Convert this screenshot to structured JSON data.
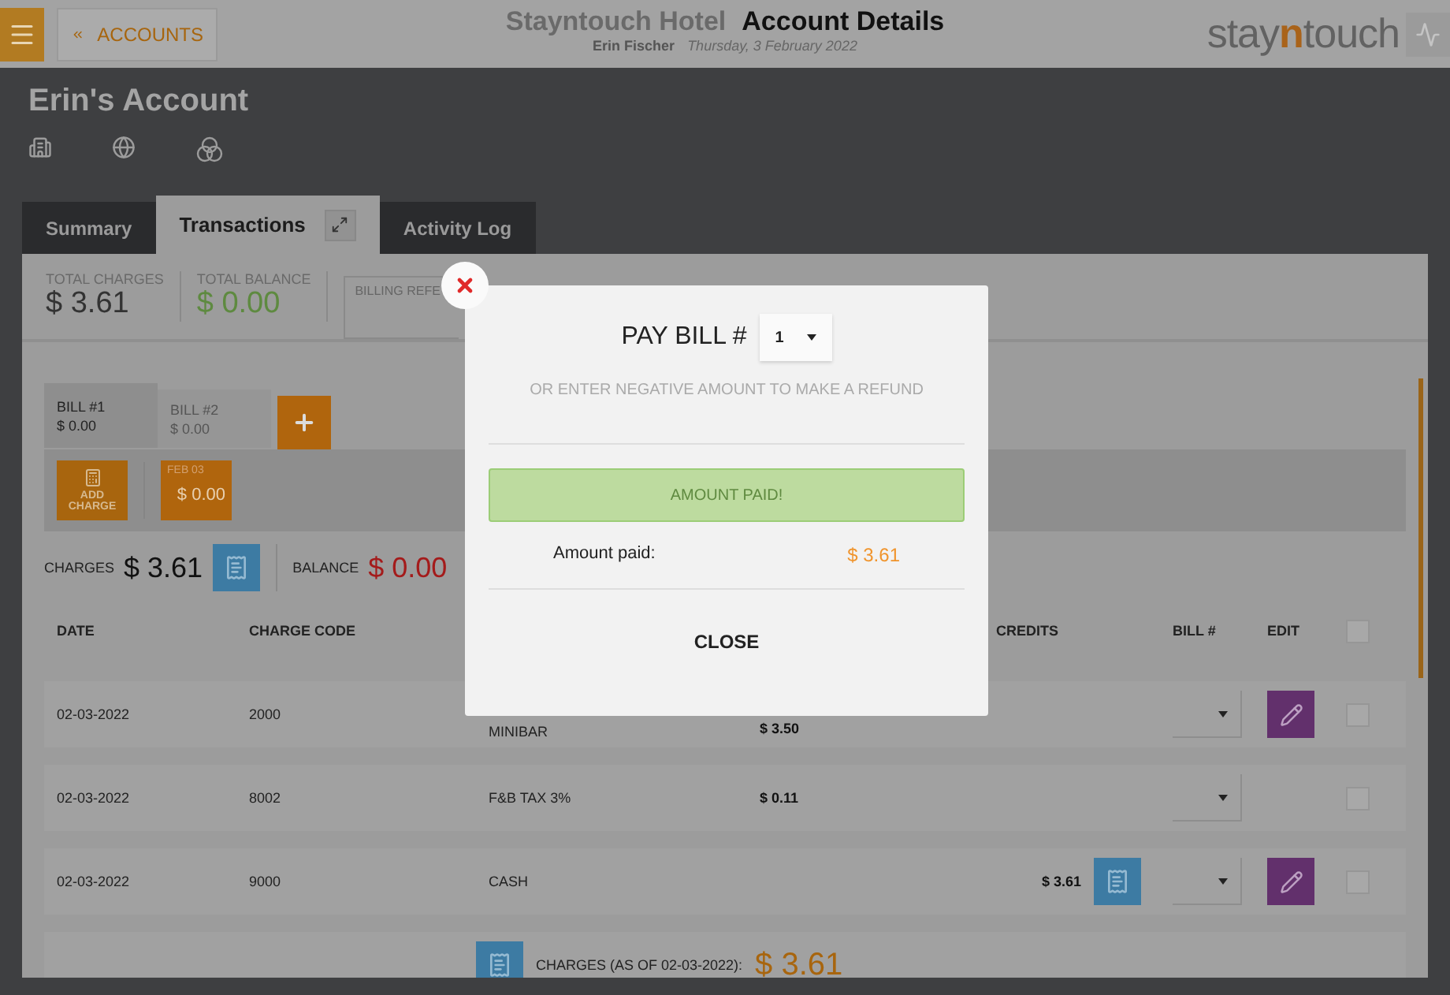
{
  "header": {
    "back_button": "ACCOUNTS",
    "hotel": "Stayntouch Hotel",
    "page_title": "Account Details",
    "user": "Erin Fischer",
    "date": "Thursday, 3 February 2022",
    "logo": [
      {
        "text": "stay",
        "highlight": false
      },
      {
        "text": "n",
        "highlight": true
      },
      {
        "text": "touch",
        "highlight": false
      }
    ]
  },
  "account": {
    "title": "Erin's Account"
  },
  "tabs": [
    {
      "label": "Summary",
      "selected": false
    },
    {
      "label": "Transactions",
      "selected": true
    },
    {
      "label": "Activity Log",
      "selected": false
    }
  ],
  "summary": [
    {
      "label": "TOTAL CHARGES",
      "value": "$ 3.61",
      "kind": "plain"
    },
    {
      "label": "TOTAL BALANCE",
      "value": "$ 0.00",
      "kind": "positive"
    }
  ],
  "billing_reference": {
    "label": "BILLING REFE"
  },
  "bills": [
    {
      "label": "BILL #1",
      "amount": "$ 0.00",
      "selected": true
    },
    {
      "label": "BILL #2",
      "amount": "$ 0.00",
      "selected": false
    }
  ],
  "add_charge": {
    "label": "ADD CHARGE"
  },
  "date_card": {
    "date": "FEB 03",
    "amount": "$ 0.00"
  },
  "totals": {
    "charges_label": "CHARGES",
    "charges": "$ 3.61",
    "balance_label": "BALANCE",
    "balance": "$ 0.00"
  },
  "table": {
    "columns": [
      "DATE",
      "CHARGE CODE",
      "CREDITS",
      "BILL #",
      "EDIT"
    ],
    "header_checked": false,
    "rows": [
      {
        "date": "02-03-2022",
        "code": "2000",
        "description": "MINIBAR",
        "charges": "$ 3.50",
        "credits": "",
        "receipt": false,
        "editable": true,
        "checked": false
      },
      {
        "date": "02-03-2022",
        "code": "8002",
        "description": "F&B TAX 3%",
        "charges": "$ 0.11",
        "credits": "",
        "receipt": false,
        "editable": false,
        "checked": false
      },
      {
        "date": "02-03-2022",
        "code": "9000",
        "description": "CASH",
        "charges": "",
        "credits": "$ 3.61",
        "receipt": true,
        "editable": true,
        "checked": false
      }
    ],
    "footer": {
      "label": "CHARGES (AS OF 02-03-2022):",
      "amount": "$ 3.61"
    }
  },
  "modal": {
    "title": "PAY BILL #",
    "bill_select": "1",
    "hint": "OR ENTER NEGATIVE AMOUNT TO MAKE A REFUND",
    "status": "AMOUNT PAID!",
    "amount_label": "Amount paid:",
    "amount": "$ 3.61",
    "close": "CLOSE"
  }
}
